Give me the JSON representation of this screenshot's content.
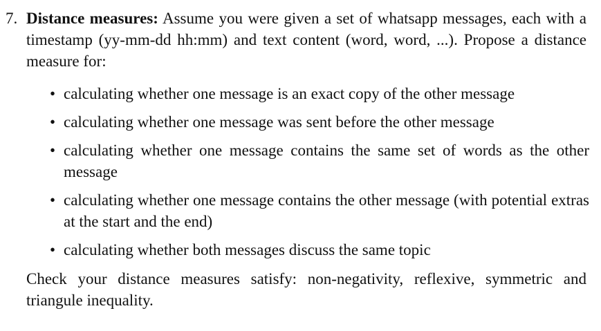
{
  "question": {
    "number": "7.",
    "heading": "Distance measures:",
    "intro": " Assume you were given a set of whatsapp messages, each with a timestamp (yy-mm-dd hh:mm) and text content (word, word, ...). Propose a distance measure for:",
    "bullets": [
      "calculating whether one message is an exact copy of the other message",
      "calculating whether one message was sent before the other message",
      "calculating whether one message contains the same set of words as the other message",
      "calculating whether one message contains the other message (with potential extras at the start and the end)",
      "calculating whether both messages discuss the same topic"
    ],
    "closing": "Check your distance measures satisfy: non-negativity, reflexive, symmetric and triangule inequality."
  }
}
